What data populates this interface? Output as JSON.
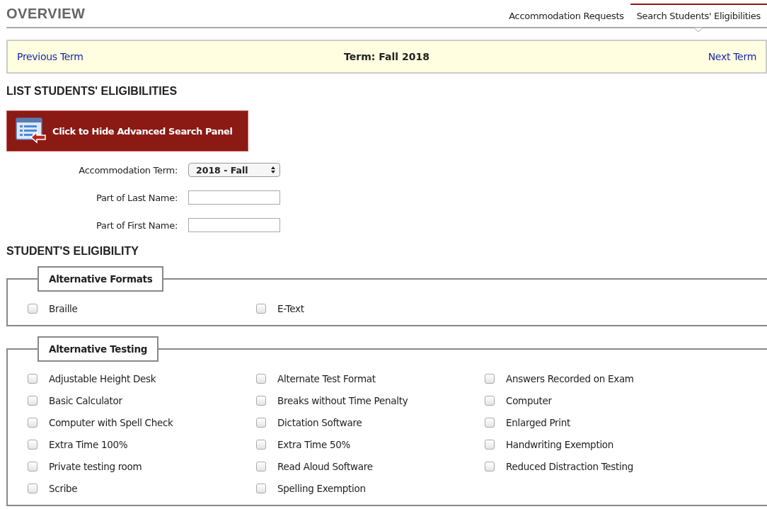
{
  "header": {
    "title": "OVERVIEW",
    "tabs": [
      {
        "label": "Accommodation Requests",
        "selected": false
      },
      {
        "label": "Search Students' Eligibilities",
        "selected": true
      }
    ]
  },
  "term_bar": {
    "previous": "Previous Term",
    "term": "Term: Fall 2018",
    "next": "Next Term"
  },
  "list_heading": "LIST STUDENTS' ELIGIBILITIES",
  "toggle_button": "Click to Hide Advanced Search Panel",
  "form": [
    {
      "kind": "select",
      "label": "Accommodation Term:",
      "value": "2018 - Fall"
    },
    {
      "kind": "text",
      "label": "Part of Last Name:"
    },
    {
      "kind": "text",
      "label": "Part of First Name:"
    }
  ],
  "eligibility_heading": "STUDENT'S ELIGIBILITY",
  "groups": [
    {
      "legend": "Alternative Formats",
      "items": [
        {
          "label": "Braille",
          "checked": false
        },
        {
          "label": "E-Text",
          "checked": false
        }
      ]
    },
    {
      "legend": "Alternative Testing",
      "items": [
        {
          "label": "Adjustable Height Desk",
          "checked": false
        },
        {
          "label": "Alternate Test Format",
          "checked": false
        },
        {
          "label": "Answers Recorded on Exam",
          "checked": false
        },
        {
          "label": "Basic Calculator",
          "checked": false
        },
        {
          "label": "Breaks without Time Penalty",
          "checked": false
        },
        {
          "label": "Computer",
          "checked": false
        },
        {
          "label": "Computer with Spell Check",
          "checked": false
        },
        {
          "label": "Dictation Software",
          "checked": false
        },
        {
          "label": "Enlarged Print",
          "checked": false
        },
        {
          "label": "Extra Time 100%",
          "checked": false
        },
        {
          "label": "Extra Time 50%",
          "checked": false
        },
        {
          "label": "Handwriting Exemption",
          "checked": false
        },
        {
          "label": "Private testing room",
          "checked": false
        },
        {
          "label": "Read Aloud Software",
          "checked": false
        },
        {
          "label": "Reduced Distraction Testing",
          "checked": false
        },
        {
          "label": "Scribe",
          "checked": false
        },
        {
          "label": "Spelling Exemption",
          "checked": false
        }
      ]
    }
  ]
}
